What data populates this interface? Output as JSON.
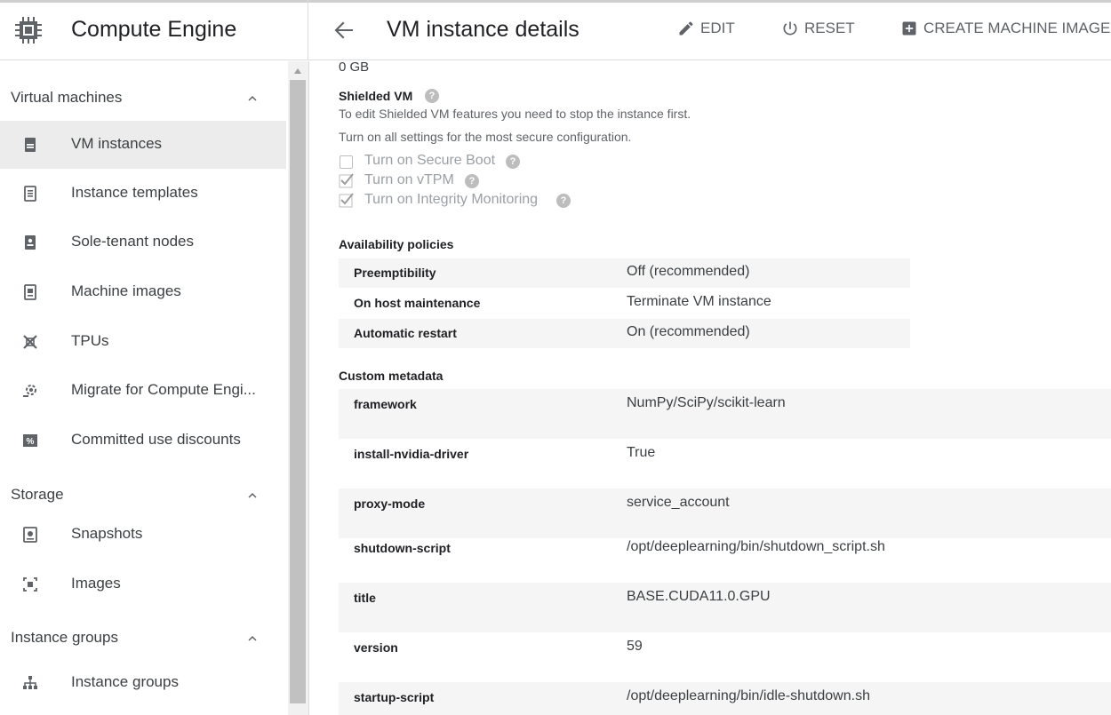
{
  "header": {
    "app_title": "Compute Engine",
    "page_title": "VM instance details",
    "actions": [
      {
        "label": "EDIT",
        "icon": "pencil-icon"
      },
      {
        "label": "RESET",
        "icon": "power-icon"
      },
      {
        "label": "CREATE MACHINE IMAGE",
        "icon": "add-box-icon"
      }
    ]
  },
  "sidebar": {
    "sections": [
      {
        "label": "Virtual machines"
      },
      {
        "label": "Storage"
      },
      {
        "label": "Instance groups"
      }
    ],
    "items": [
      {
        "label": "VM instances",
        "icon": "vm-instance-icon"
      },
      {
        "label": "Instance templates",
        "icon": "template-icon"
      },
      {
        "label": "Sole-tenant nodes",
        "icon": "sole-tenant-icon"
      },
      {
        "label": "Machine images",
        "icon": "machine-image-icon"
      },
      {
        "label": "TPUs",
        "icon": "tpu-icon"
      },
      {
        "label": "Migrate for Compute Engi...",
        "icon": "migrate-icon"
      },
      {
        "label": "Committed use discounts",
        "icon": "percent-icon"
      },
      {
        "label": "Snapshots",
        "icon": "snapshot-icon"
      },
      {
        "label": "Images",
        "icon": "images-icon"
      },
      {
        "label": "Instance groups",
        "icon": "instance-groups-icon"
      }
    ]
  },
  "main": {
    "disk_size": "0 GB",
    "shielded": {
      "title": "Shielded VM",
      "note1": "To edit Shielded VM features you need to stop the instance first.",
      "note2": "Turn on all settings for the most secure configuration.",
      "options": [
        {
          "label": "Turn on Secure Boot",
          "checked": false
        },
        {
          "label": "Turn on vTPM",
          "checked": true
        },
        {
          "label": "Turn on Integrity Monitoring",
          "checked": true
        }
      ]
    },
    "availability": {
      "title": "Availability policies",
      "rows": [
        {
          "key": "Preemptibility",
          "value": "Off (recommended)"
        },
        {
          "key": "On host maintenance",
          "value": "Terminate VM instance"
        },
        {
          "key": "Automatic restart",
          "value": "On (recommended)"
        }
      ]
    },
    "metadata": {
      "title": "Custom metadata",
      "rows": [
        {
          "key": "framework",
          "value": "NumPy/SciPy/scikit-learn"
        },
        {
          "key": "install-nvidia-driver",
          "value": "True"
        },
        {
          "key": "proxy-mode",
          "value": "service_account"
        },
        {
          "key": "shutdown-script",
          "value": "/opt/deeplearning/bin/shutdown_script.sh"
        },
        {
          "key": "title",
          "value": "BASE.CUDA11.0.GPU"
        },
        {
          "key": "version",
          "value": "59"
        },
        {
          "key": "startup-script",
          "value": "/opt/deeplearning/bin/idle-shutdown.sh"
        }
      ]
    }
  }
}
